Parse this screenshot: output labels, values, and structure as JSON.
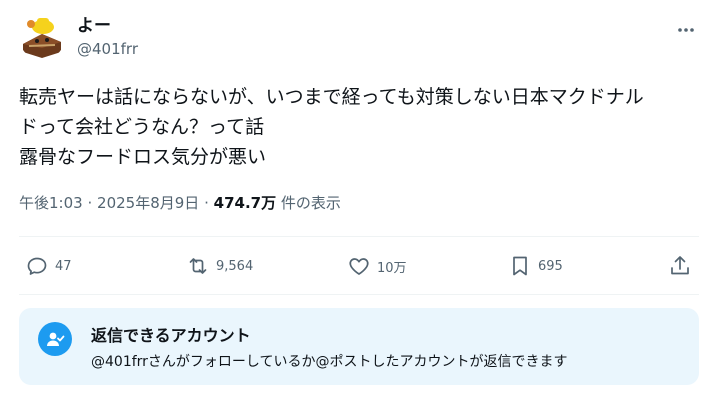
{
  "author": {
    "display_name": "よー",
    "handle": "@401frr",
    "avatar_icon": "chocolate-cake-character-avatar"
  },
  "tweet": {
    "lines": [
      "転売ヤーは話にならないが、いつまで経っても対策しない日本マクドナル",
      "ドって会社どうなん？って話",
      "露骨なフードロス気分が悪い"
    ]
  },
  "meta": {
    "time": "午後1:03",
    "separator": "·",
    "date": "2025年8月9日",
    "views_count": "474.7万",
    "views_label": "件の表示"
  },
  "actions": {
    "reply": {
      "icon": "reply-icon",
      "count": "47"
    },
    "retweet": {
      "icon": "retweet-icon",
      "count": "9,564"
    },
    "like": {
      "icon": "heart-icon",
      "count": "10万"
    },
    "bookmark": {
      "icon": "bookmark-icon",
      "count": "695"
    },
    "share": {
      "icon": "share-icon"
    }
  },
  "reply_restriction": {
    "icon": "mention-icon",
    "title": "返信できるアカウント",
    "description": "@401frrさんがフォローしているか@ポストしたアカウントが返信できます"
  },
  "colors": {
    "text": "#0f1419",
    "secondary": "#536471",
    "accent": "#1d9bf0",
    "info_bg": "#eaf6fd",
    "divider": "#eff3f4"
  }
}
